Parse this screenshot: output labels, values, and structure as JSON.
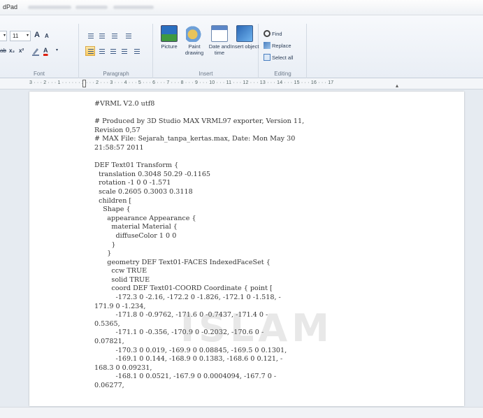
{
  "window": {
    "app_title": "dPad"
  },
  "ribbon": {
    "font": {
      "size_value": "11",
      "grow_label": "A",
      "shrink_label": "A",
      "strike_label": "ab",
      "subscript_label": "x₂",
      "superscript_label": "x²",
      "color_label": "A",
      "group_label": "Font"
    },
    "paragraph": {
      "group_label": "Paragraph"
    },
    "insert": {
      "picture_label": "Picture",
      "paint_label": "Paint drawing",
      "datetime_label": "Date and time",
      "object_label": "Insert object",
      "group_label": "Insert"
    },
    "editing": {
      "find_label": "Find",
      "replace_label": "Replace",
      "select_all_label": "Select all",
      "group_label": "Editing"
    }
  },
  "ruler": {
    "text": "3 · · · 2 · · · 1 · · · · · · 1 · · · 2 · · · 3 · · · 4 · · · 5 · · · 6 · · · 7 · · · 8 · · · 9 · · · 10 · · · 11 · · · 12 · · · 13 · · · 14 · · · 15 · · · 16 · · · 17"
  },
  "document": {
    "lines": [
      "#VRML V2.0 utf8",
      "",
      "# Produced by 3D Studio MAX VRML97 exporter, Version 11,",
      "Revision 0,57",
      "# MAX File: Sejarah_tanpa_kertas.max, Date: Mon May 30",
      "21:58:57 2011",
      "",
      "DEF Text01 Transform {",
      "  translation 0.3048 50.29 -0.1165",
      "  rotation -1 0 0 -1.571",
      "  scale 0.2605 0.3003 0.3118",
      "  children [",
      "    Shape {",
      "      appearance Appearance {",
      "        material Material {",
      "          diffuseColor 1 0 0",
      "        }",
      "      }",
      "      geometry DEF Text01-FACES IndexedFaceSet {",
      "        ccw TRUE",
      "        solid TRUE",
      "        coord DEF Text01-COORD Coordinate { point [",
      "          -172.3 0 -2.16, -172.2 0 -1.826, -172.1 0 -1.518, -",
      "171.9 0 -1.234,",
      "          -171.8 0 -0.9762, -171.6 0 -0.7437, -171.4 0 -",
      "0.5365,",
      "          -171.1 0 -0.356, -170.9 0 -0.2032, -170.6 0 -",
      "0.07821,",
      "          -170.3 0 0.019, -169.9 0 0.08845, -169.5 0 0.1301,",
      "          -169.1 0 0.144, -168.9 0 0.1383, -168.6 0 0.121, -",
      "168.3 0 0.09231,",
      "          -168.1 0 0.0521, -167.9 0 0.0004094, -167.7 0 -",
      "0.06277,"
    ]
  },
  "watermark": {
    "text": "ISLAM"
  }
}
